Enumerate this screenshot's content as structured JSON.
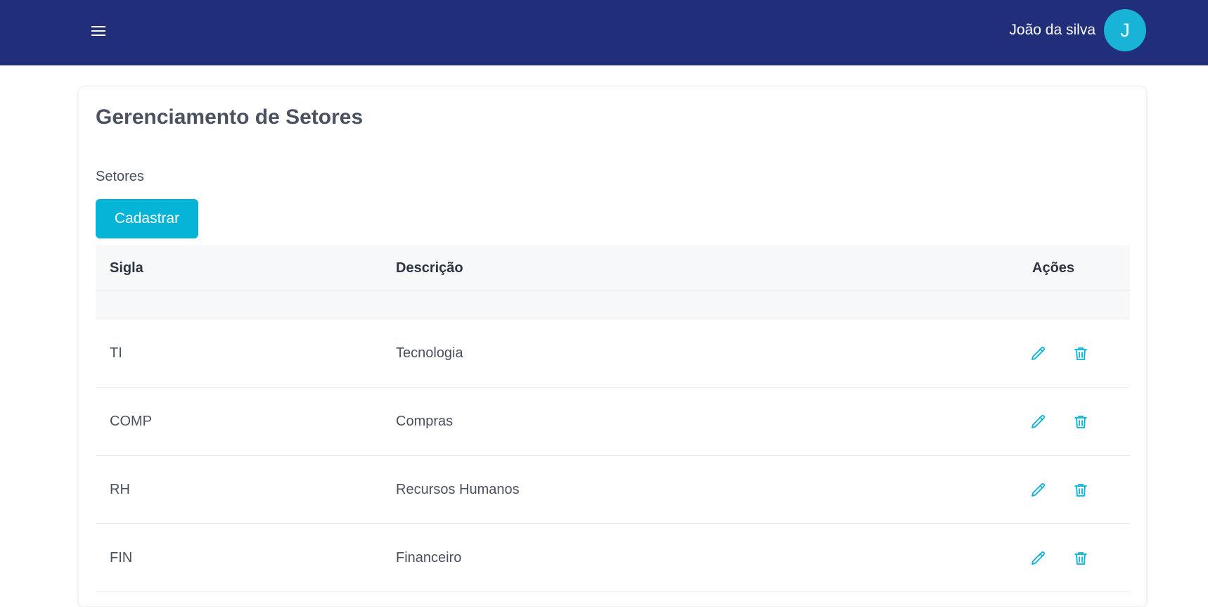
{
  "header": {
    "user_name": "João da silva",
    "avatar_initial": "J"
  },
  "page": {
    "title": "Gerenciamento de Setores",
    "section_label": "Setores",
    "register_button": "Cadastrar"
  },
  "table": {
    "columns": [
      "Sigla",
      "Descrição",
      "Ações"
    ],
    "rows": [
      {
        "sigla": "TI",
        "descricao": "Tecnologia"
      },
      {
        "sigla": "COMP",
        "descricao": "Compras"
      },
      {
        "sigla": "RH",
        "descricao": "Recursos Humanos"
      },
      {
        "sigla": "FIN",
        "descricao": "Financeiro"
      }
    ],
    "row_actions": [
      "pencil-icon",
      "trash-icon"
    ]
  },
  "colors": {
    "header_bg": "#212e79",
    "accent": "#06b4d8",
    "avatar_bg": "#1ab3d8"
  }
}
